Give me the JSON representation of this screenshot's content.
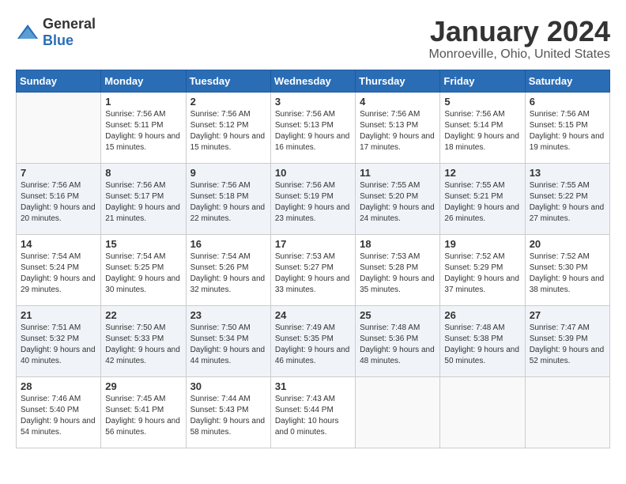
{
  "header": {
    "logo_general": "General",
    "logo_blue": "Blue",
    "month_title": "January 2024",
    "location": "Monroeville, Ohio, United States"
  },
  "days_of_week": [
    "Sunday",
    "Monday",
    "Tuesday",
    "Wednesday",
    "Thursday",
    "Friday",
    "Saturday"
  ],
  "weeks": [
    [
      {
        "day": "",
        "sunrise": "",
        "sunset": "",
        "daylight": ""
      },
      {
        "day": "1",
        "sunrise": "Sunrise: 7:56 AM",
        "sunset": "Sunset: 5:11 PM",
        "daylight": "Daylight: 9 hours and 15 minutes."
      },
      {
        "day": "2",
        "sunrise": "Sunrise: 7:56 AM",
        "sunset": "Sunset: 5:12 PM",
        "daylight": "Daylight: 9 hours and 15 minutes."
      },
      {
        "day": "3",
        "sunrise": "Sunrise: 7:56 AM",
        "sunset": "Sunset: 5:13 PM",
        "daylight": "Daylight: 9 hours and 16 minutes."
      },
      {
        "day": "4",
        "sunrise": "Sunrise: 7:56 AM",
        "sunset": "Sunset: 5:13 PM",
        "daylight": "Daylight: 9 hours and 17 minutes."
      },
      {
        "day": "5",
        "sunrise": "Sunrise: 7:56 AM",
        "sunset": "Sunset: 5:14 PM",
        "daylight": "Daylight: 9 hours and 18 minutes."
      },
      {
        "day": "6",
        "sunrise": "Sunrise: 7:56 AM",
        "sunset": "Sunset: 5:15 PM",
        "daylight": "Daylight: 9 hours and 19 minutes."
      }
    ],
    [
      {
        "day": "7",
        "sunrise": "Sunrise: 7:56 AM",
        "sunset": "Sunset: 5:16 PM",
        "daylight": "Daylight: 9 hours and 20 minutes."
      },
      {
        "day": "8",
        "sunrise": "Sunrise: 7:56 AM",
        "sunset": "Sunset: 5:17 PM",
        "daylight": "Daylight: 9 hours and 21 minutes."
      },
      {
        "day": "9",
        "sunrise": "Sunrise: 7:56 AM",
        "sunset": "Sunset: 5:18 PM",
        "daylight": "Daylight: 9 hours and 22 minutes."
      },
      {
        "day": "10",
        "sunrise": "Sunrise: 7:56 AM",
        "sunset": "Sunset: 5:19 PM",
        "daylight": "Daylight: 9 hours and 23 minutes."
      },
      {
        "day": "11",
        "sunrise": "Sunrise: 7:55 AM",
        "sunset": "Sunset: 5:20 PM",
        "daylight": "Daylight: 9 hours and 24 minutes."
      },
      {
        "day": "12",
        "sunrise": "Sunrise: 7:55 AM",
        "sunset": "Sunset: 5:21 PM",
        "daylight": "Daylight: 9 hours and 26 minutes."
      },
      {
        "day": "13",
        "sunrise": "Sunrise: 7:55 AM",
        "sunset": "Sunset: 5:22 PM",
        "daylight": "Daylight: 9 hours and 27 minutes."
      }
    ],
    [
      {
        "day": "14",
        "sunrise": "Sunrise: 7:54 AM",
        "sunset": "Sunset: 5:24 PM",
        "daylight": "Daylight: 9 hours and 29 minutes."
      },
      {
        "day": "15",
        "sunrise": "Sunrise: 7:54 AM",
        "sunset": "Sunset: 5:25 PM",
        "daylight": "Daylight: 9 hours and 30 minutes."
      },
      {
        "day": "16",
        "sunrise": "Sunrise: 7:54 AM",
        "sunset": "Sunset: 5:26 PM",
        "daylight": "Daylight: 9 hours and 32 minutes."
      },
      {
        "day": "17",
        "sunrise": "Sunrise: 7:53 AM",
        "sunset": "Sunset: 5:27 PM",
        "daylight": "Daylight: 9 hours and 33 minutes."
      },
      {
        "day": "18",
        "sunrise": "Sunrise: 7:53 AM",
        "sunset": "Sunset: 5:28 PM",
        "daylight": "Daylight: 9 hours and 35 minutes."
      },
      {
        "day": "19",
        "sunrise": "Sunrise: 7:52 AM",
        "sunset": "Sunset: 5:29 PM",
        "daylight": "Daylight: 9 hours and 37 minutes."
      },
      {
        "day": "20",
        "sunrise": "Sunrise: 7:52 AM",
        "sunset": "Sunset: 5:30 PM",
        "daylight": "Daylight: 9 hours and 38 minutes."
      }
    ],
    [
      {
        "day": "21",
        "sunrise": "Sunrise: 7:51 AM",
        "sunset": "Sunset: 5:32 PM",
        "daylight": "Daylight: 9 hours and 40 minutes."
      },
      {
        "day": "22",
        "sunrise": "Sunrise: 7:50 AM",
        "sunset": "Sunset: 5:33 PM",
        "daylight": "Daylight: 9 hours and 42 minutes."
      },
      {
        "day": "23",
        "sunrise": "Sunrise: 7:50 AM",
        "sunset": "Sunset: 5:34 PM",
        "daylight": "Daylight: 9 hours and 44 minutes."
      },
      {
        "day": "24",
        "sunrise": "Sunrise: 7:49 AM",
        "sunset": "Sunset: 5:35 PM",
        "daylight": "Daylight: 9 hours and 46 minutes."
      },
      {
        "day": "25",
        "sunrise": "Sunrise: 7:48 AM",
        "sunset": "Sunset: 5:36 PM",
        "daylight": "Daylight: 9 hours and 48 minutes."
      },
      {
        "day": "26",
        "sunrise": "Sunrise: 7:48 AM",
        "sunset": "Sunset: 5:38 PM",
        "daylight": "Daylight: 9 hours and 50 minutes."
      },
      {
        "day": "27",
        "sunrise": "Sunrise: 7:47 AM",
        "sunset": "Sunset: 5:39 PM",
        "daylight": "Daylight: 9 hours and 52 minutes."
      }
    ],
    [
      {
        "day": "28",
        "sunrise": "Sunrise: 7:46 AM",
        "sunset": "Sunset: 5:40 PM",
        "daylight": "Daylight: 9 hours and 54 minutes."
      },
      {
        "day": "29",
        "sunrise": "Sunrise: 7:45 AM",
        "sunset": "Sunset: 5:41 PM",
        "daylight": "Daylight: 9 hours and 56 minutes."
      },
      {
        "day": "30",
        "sunrise": "Sunrise: 7:44 AM",
        "sunset": "Sunset: 5:43 PM",
        "daylight": "Daylight: 9 hours and 58 minutes."
      },
      {
        "day": "31",
        "sunrise": "Sunrise: 7:43 AM",
        "sunset": "Sunset: 5:44 PM",
        "daylight": "Daylight: 10 hours and 0 minutes."
      },
      {
        "day": "",
        "sunrise": "",
        "sunset": "",
        "daylight": ""
      },
      {
        "day": "",
        "sunrise": "",
        "sunset": "",
        "daylight": ""
      },
      {
        "day": "",
        "sunrise": "",
        "sunset": "",
        "daylight": ""
      }
    ]
  ]
}
